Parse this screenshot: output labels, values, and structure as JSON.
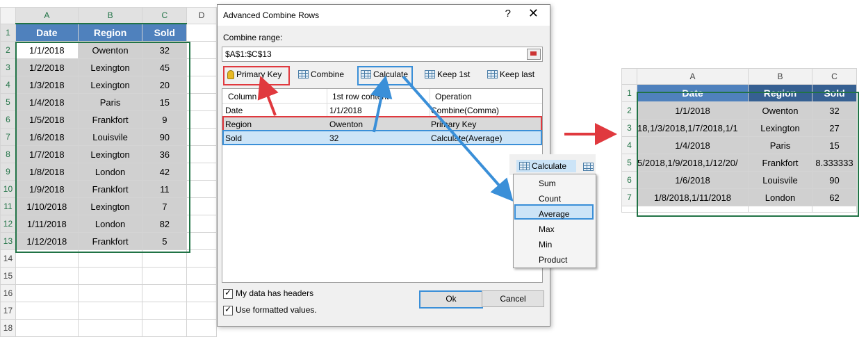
{
  "left_sheet": {
    "columns": [
      "A",
      "B",
      "C",
      "D"
    ],
    "headers": [
      "Date",
      "Region",
      "Sold"
    ],
    "rows": [
      [
        "1/1/2018",
        "Owenton",
        "32"
      ],
      [
        "1/2/2018",
        "Lexington",
        "45"
      ],
      [
        "1/3/2018",
        "Lexington",
        "20"
      ],
      [
        "1/4/2018",
        "Paris",
        "15"
      ],
      [
        "1/5/2018",
        "Frankfort",
        "9"
      ],
      [
        "1/6/2018",
        "Louisvile",
        "90"
      ],
      [
        "1/7/2018",
        "Lexington",
        "36"
      ],
      [
        "1/8/2018",
        "London",
        "42"
      ],
      [
        "1/9/2018",
        "Frankfort",
        "11"
      ],
      [
        "1/10/2018",
        "Lexington",
        "7"
      ],
      [
        "1/11/2018",
        "London",
        "82"
      ],
      [
        "1/12/2018",
        "Frankfort",
        "5"
      ]
    ],
    "row_numbers": [
      "1",
      "2",
      "3",
      "4",
      "5",
      "6",
      "7",
      "8",
      "9",
      "10",
      "11",
      "12",
      "13",
      "14",
      "15",
      "16",
      "17",
      "18"
    ]
  },
  "dialog": {
    "title": "Advanced Combine Rows",
    "help": "?",
    "close": "✕",
    "range_label": "Combine range:",
    "range_value": "$A$1:$C$13",
    "toolbar": {
      "primary_key": "Primary Key",
      "combine": "Combine",
      "calculate": "Calculate",
      "keep_first": "Keep 1st",
      "keep_last": "Keep last"
    },
    "grid_headers": [
      "Column",
      "1st row content",
      "Operation"
    ],
    "grid_rows": [
      [
        "Date",
        "1/1/2018",
        "Combine(Comma)"
      ],
      [
        "Region",
        "Owenton",
        "Primary Key"
      ],
      [
        "Sold",
        "32",
        "Calculate(Average)"
      ]
    ],
    "chk_headers": "My data has headers",
    "chk_formatted": "Use formatted values.",
    "ok": "Ok",
    "cancel": "Cancel"
  },
  "calc_menu": {
    "button": "Calculate",
    "items": [
      "Sum",
      "Count",
      "Average",
      "Max",
      "Min",
      "Product"
    ],
    "selected": "Average"
  },
  "right_sheet": {
    "columns": [
      "A",
      "B",
      "C"
    ],
    "headers": [
      "Date",
      "Region",
      "Sold"
    ],
    "rows": [
      [
        "1/1/2018",
        "Owenton",
        "32"
      ],
      [
        "18,1/3/2018,1/7/2018,1/1",
        "Lexington",
        "27"
      ],
      [
        "1/4/2018",
        "Paris",
        "15"
      ],
      [
        "/5/2018,1/9/2018,1/12/20",
        "Frankfort",
        "8.333333"
      ],
      [
        "1/6/2018",
        "Louisvile",
        "90"
      ],
      [
        "1/8/2018,1/11/2018",
        "London",
        "62"
      ]
    ],
    "row_numbers": [
      "1",
      "2",
      "3",
      "4",
      "5",
      "6",
      "7"
    ]
  },
  "colors": {
    "excel_green": "#217346",
    "header_blue": "#4f81bd",
    "highlight_red": "#e0393e",
    "highlight_blue": "#3a8fd8"
  }
}
